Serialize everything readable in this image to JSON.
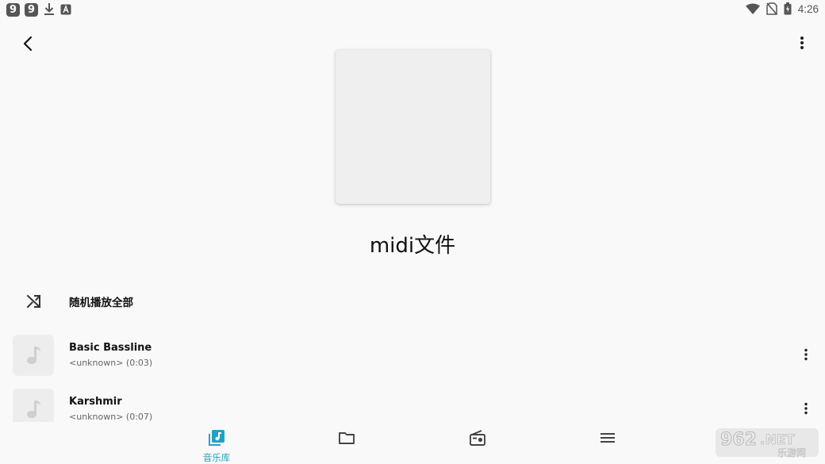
{
  "status_bar": {
    "left_badges": [
      "9",
      "9"
    ],
    "icons": [
      "download-icon",
      "a-icon",
      "wifi-icon",
      "no-sim-icon",
      "battery-icon"
    ],
    "time": "4:26"
  },
  "header": {
    "back_icon": "back-arrow-icon",
    "menu_icon": "more-vert-icon"
  },
  "playlist": {
    "title": "midi文件"
  },
  "shuffle": {
    "label": "随机播放全部",
    "icon": "shuffle-icon"
  },
  "tracks": [
    {
      "title": "Basic Bassline",
      "subtitle": "<unknown> (0:03)"
    },
    {
      "title": "Karshmir",
      "subtitle": "<unknown> (0:07)"
    }
  ],
  "bottom_nav": [
    {
      "id": "library",
      "label": "音乐库",
      "icon": "library-music-icon",
      "active": true
    },
    {
      "id": "folders",
      "label": "",
      "icon": "folder-icon",
      "active": false
    },
    {
      "id": "radio",
      "label": "",
      "icon": "radio-icon",
      "active": false
    },
    {
      "id": "menu",
      "label": "",
      "icon": "menu-icon",
      "active": false
    }
  ],
  "watermark": {
    "text": "962.NET",
    "subtext": "乐游网"
  },
  "colors": {
    "background": "#f9f9f9",
    "accent": "#24a0c4",
    "icon": "#555555",
    "text_primary": "#111111",
    "text_secondary": "#666666"
  }
}
